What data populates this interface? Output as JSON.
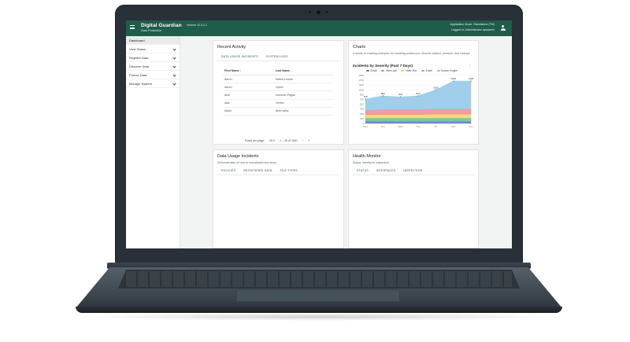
{
  "header": {
    "brand": "Digital Guardian",
    "brand_sub": "Data Protection",
    "version": "Version   10.0.2.1",
    "app_mode": "Application Mode: Standalone (TM)",
    "logged_in": "Logged in: Administrator  sysadmin"
  },
  "sidebar": {
    "items": [
      {
        "label": "Dashboard"
      },
      {
        "label": "View Status"
      },
      {
        "label": "Register Data"
      },
      {
        "label": "Discover Data"
      },
      {
        "label": "Protect Data"
      },
      {
        "label": "Manage System"
      }
    ]
  },
  "recent_activity": {
    "title": "Recent Activity",
    "tabs": [
      "DATA USAGE INCIDENTS",
      "SYSTEM LOGS"
    ],
    "columns": [
      "First Name ↑",
      "Last Name"
    ],
    "rows": [
      [
        "Aaron",
        "Walsh-Lemke"
      ],
      [
        "Aaron",
        "Upton"
      ],
      [
        "Abel",
        "Kemmer-Pagac"
      ],
      [
        "Ada",
        "Herbst"
      ],
      [
        "Adam",
        "Abernathy"
      ]
    ],
    "rows_per_page_label": "Rows per page:",
    "rows_per_page": "25 ▾",
    "range": "1 – 25 of 1001",
    "link": "VIEW ACTIVITIES"
  },
  "charts_card": {
    "title": "Charts",
    "subtitle": "A series of charting examples for handling continuous, discrete actions, prompts, and lookups",
    "link": "VIEW CHARTS"
  },
  "data_usage": {
    "title": "Data Usage Incidents",
    "subtitle": "Demonstration of how to format/add/view items",
    "tabs": [
      "POLICIES",
      "REGISTERED DATA",
      "FILE TYPES"
    ]
  },
  "health_monitor": {
    "title": "Health Monitor",
    "subtitle": "Status, interfaces, inspection",
    "tabs": [
      "STATUS",
      "INTERFACES",
      "INSPECTION"
    ]
  },
  "chart_data": {
    "type": "area",
    "title": "Incidents by Severity (Past 7 Days)",
    "categories": [
      "Mon",
      "Tue",
      "Wed",
      "Thu",
      "Fri",
      "Sat",
      "Sun"
    ],
    "ylim": [
      0,
      1500
    ],
    "yticks": [
      0,
      150,
      300,
      450,
      600,
      750,
      900,
      1050,
      1200,
      1350,
      1500
    ],
    "totals": [
      765,
      863,
      831,
      863,
      1050,
      1325,
      1325
    ],
    "series": [
      {
        "name": "Email",
        "color": "#6b6fc9",
        "values": [
          60,
          60,
          60,
          60,
          60,
          60,
          60
        ]
      },
      {
        "name": "Other Apt",
        "color": "#5fbf94",
        "values": [
          110,
          110,
          110,
          110,
          110,
          110,
          110
        ]
      },
      {
        "name": "Video Rdr",
        "color": "#f3d46a",
        "values": [
          100,
          110,
          110,
          110,
          120,
          120,
          120
        ]
      },
      {
        "name": "Email",
        "color": "#f08a8f",
        "values": [
          140,
          150,
          150,
          150,
          160,
          160,
          160
        ]
      },
      {
        "name": "Source Engine",
        "color": "#8fc6e8",
        "values": [
          355,
          433,
          401,
          433,
          600,
          875,
          875
        ]
      }
    ],
    "legend_placement": "top",
    "grid": true
  }
}
